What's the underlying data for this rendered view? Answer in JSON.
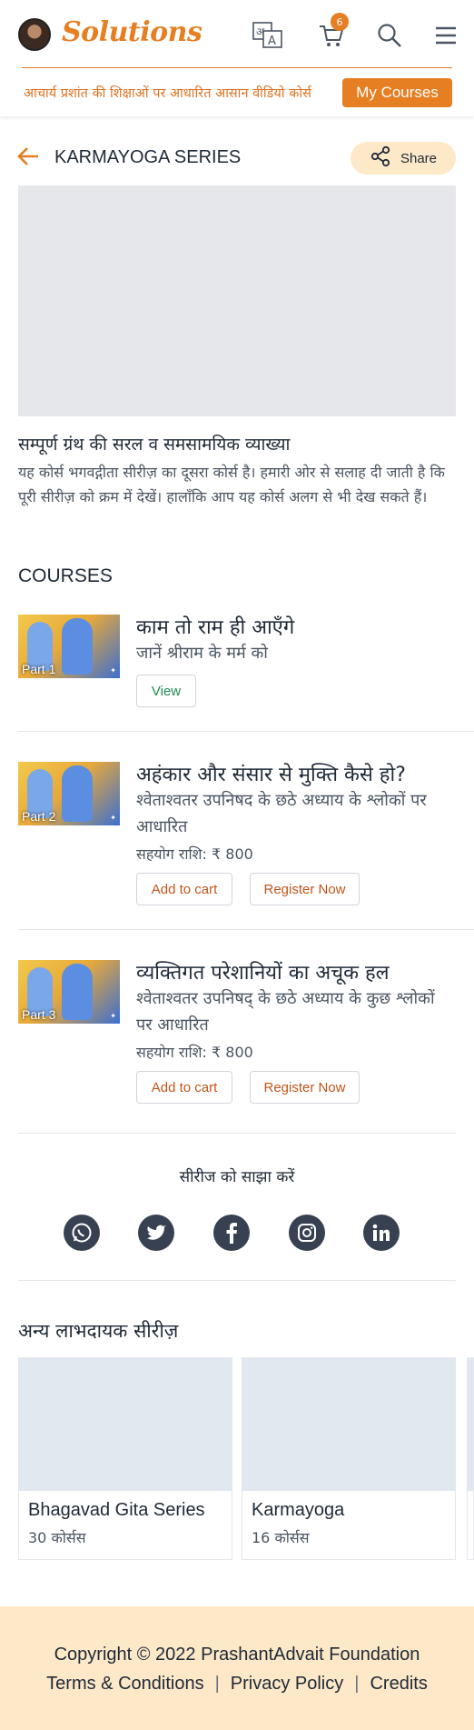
{
  "header": {
    "brand": "Solutions",
    "cart_count": "6",
    "tagline": "आचार्य प्रशांत की शिक्षाओं पर आधारित आसान वीडियो कोर्स",
    "my_courses_label": "My Courses",
    "icons": [
      "avatar",
      "translate-icon",
      "cart-icon",
      "search-icon",
      "menu-icon"
    ]
  },
  "series": {
    "title": "KARMAYOGA SERIES",
    "share_label": "Share",
    "subtitle": "सम्पूर्ण ग्रंथ की सरल व समसामयिक व्याख्या",
    "description": "यह कोर्स भगवद्गीता सीरीज़ का दूसरा कोर्स है। हमारी ओर से सलाह दी जाती है कि पूरी सीरीज़ को क्रम में देखें। हालाँकि आप यह कोर्स अलग से भी देख सकते हैं।"
  },
  "courses": {
    "heading": "COURSES",
    "items": [
      {
        "part": "Part 1",
        "title": "काम तो राम ही आएँगे",
        "subtitle": "जानें श्रीराम के मर्म को",
        "view_label": "View"
      },
      {
        "part": "Part 2",
        "title": "अहंकार और संसार से मुक्ति कैसे हो?",
        "subtitle": "श्वेताश्वतर उपनिषद के छठे अध्याय के श्लोकों पर आधारित",
        "price": "सहयोग राशि: ₹ 800",
        "add_label": "Add to cart",
        "register_label": "Register Now"
      },
      {
        "part": "Part 3",
        "title": "व्यक्तिगत परेशानियों का अचूक हल",
        "subtitle": "श्वेताश्वतर उपनिषद् के छठे अध्याय के कुछ श्लोकों पर आधारित",
        "price": "सहयोग राशि: ₹ 800",
        "add_label": "Add to cart",
        "register_label": "Register Now"
      }
    ]
  },
  "share_series": {
    "label": "सीरीज को साझा करें",
    "icons": [
      "whatsapp-icon",
      "twitter-icon",
      "facebook-icon",
      "instagram-icon",
      "linkedin-icon"
    ]
  },
  "other_series": {
    "heading": "अन्य लाभदायक सीरीज़",
    "cards": [
      {
        "title": "Bhagavad Gita Series",
        "count": "30 कोर्सस"
      },
      {
        "title": "Karmayoga",
        "count": "16 कोर्सस"
      }
    ]
  },
  "footer": {
    "copyright": "Copyright © 2022 PrashantAdvait Foundation",
    "links": [
      "Terms & Conditions",
      "Privacy Policy",
      "Credits"
    ]
  },
  "colors": {
    "accent": "#e67e22",
    "footer_bg": "#fde8c8",
    "placeholder": "#e5e7eb"
  }
}
